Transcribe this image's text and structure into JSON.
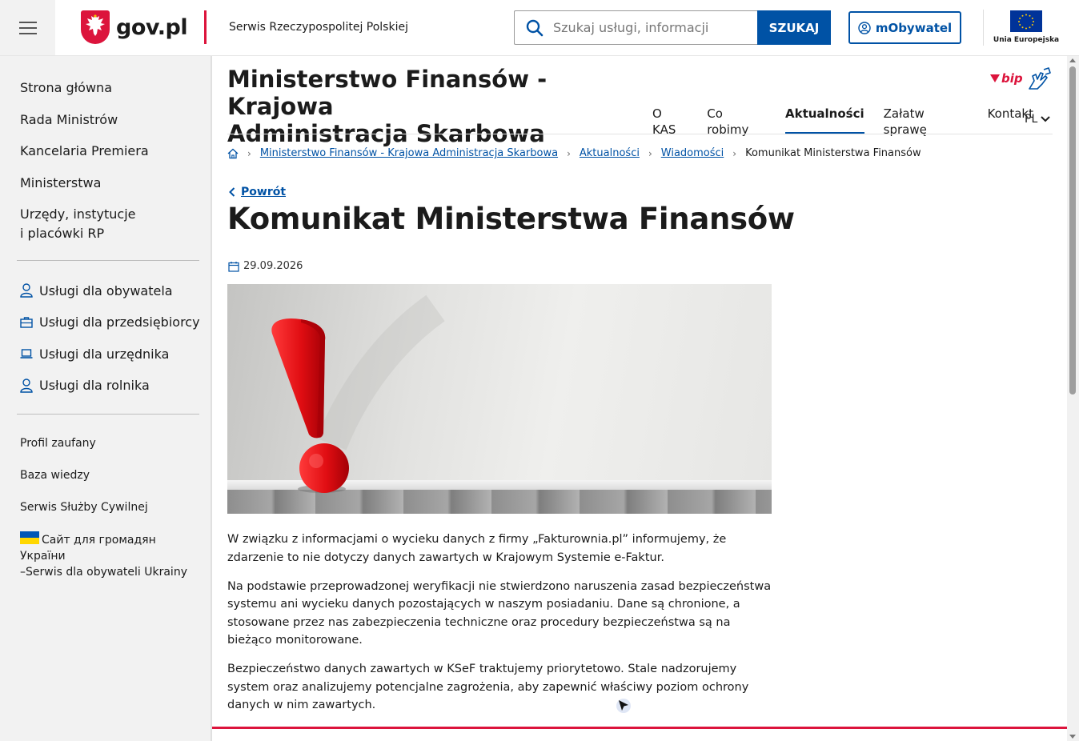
{
  "header": {
    "logo_text": "gov.pl",
    "site_name": "Serwis Rzeczypospolitej Polskiej",
    "search_placeholder": "Szukaj usługi, informacji",
    "search_button": "SZUKAJ",
    "mobywatel_label": "mObywatel",
    "eu_label": "Unia Europejska"
  },
  "sidebar": {
    "main_items": [
      {
        "label": "Strona główna"
      },
      {
        "label": "Rada Ministrów"
      },
      {
        "label": "Kancelaria Premiera"
      },
      {
        "label": "Ministerstwa"
      },
      {
        "label": "Urzędy, instytucje i placówki RP",
        "line1": "Urzędy, instytucje",
        "line2": "i placówki RP"
      }
    ],
    "services": [
      {
        "label": "Usługi dla obywatela",
        "icon": "person-icon"
      },
      {
        "label": "Usługi dla przedsiębiorcy",
        "icon": "briefcase-icon"
      },
      {
        "label": "Usługi dla urzędnika",
        "icon": "laptop-icon"
      },
      {
        "label": "Usługi dla rolnika",
        "icon": "person-icon"
      }
    ],
    "extra": [
      {
        "label": "Profil zaufany"
      },
      {
        "label": "Baza wiedzy"
      },
      {
        "label": "Serwis Służby Cywilnej"
      }
    ],
    "ukraine_line1": "Сайт для громадян України",
    "ukraine_line2": "–Serwis dla obywateli Ukrainy"
  },
  "institution": {
    "title_line1": "Ministerstwo Finansów - Krajowa",
    "title_line2": "Administracja Skarbowa",
    "bip_label": "bip",
    "nav": [
      {
        "label": "O KAS",
        "active": false
      },
      {
        "label": "Co robimy",
        "active": false
      },
      {
        "label": "Aktualności",
        "active": true
      },
      {
        "label": "Załatw sprawę",
        "active": false
      },
      {
        "label": "Kontakt",
        "active": false
      }
    ],
    "lang": "PL"
  },
  "breadcrumb": {
    "items": [
      {
        "label": "Ministerstwo Finansów - Krajowa Administracja Skarbowa"
      },
      {
        "label": "Aktualności"
      },
      {
        "label": "Wiadomości"
      }
    ],
    "current": "Komunikat Ministerstwa Finansów"
  },
  "article": {
    "back_label": "Powrót",
    "title": "Komunikat Ministerstwa Finansów",
    "date": "29.09.2026",
    "paragraphs": [
      "W związku z informacjami o wycieku danych z firmy „Fakturownia.pl” informujemy, że zdarzenie to nie dotyczy danych zawartych w Krajowym Systemie e-Faktur.",
      "Na podstawie przeprowadzonej weryfikacji nie stwierdzono naruszenia zasad bezpieczeństwa systemu ani wycieku danych pozostających w naszym posiadaniu. Dane są chronione, a stosowane przez nas zabezpieczenia techniczne oraz procedury bezpieczeństwa są na bieżąco monitorowane.",
      "Bezpieczeństwo danych zawartych w KSeF traktujemy priorytetowo. Stale nadzorujemy system oraz analizujemy potencjalne zagrożenia, aby zapewnić właściwy poziom ochrony danych w nim zawartych."
    ]
  },
  "colors": {
    "accent_blue": "#0052a5",
    "brand_red": "#dc143c",
    "sidebar_bg": "#f2f2f2"
  }
}
